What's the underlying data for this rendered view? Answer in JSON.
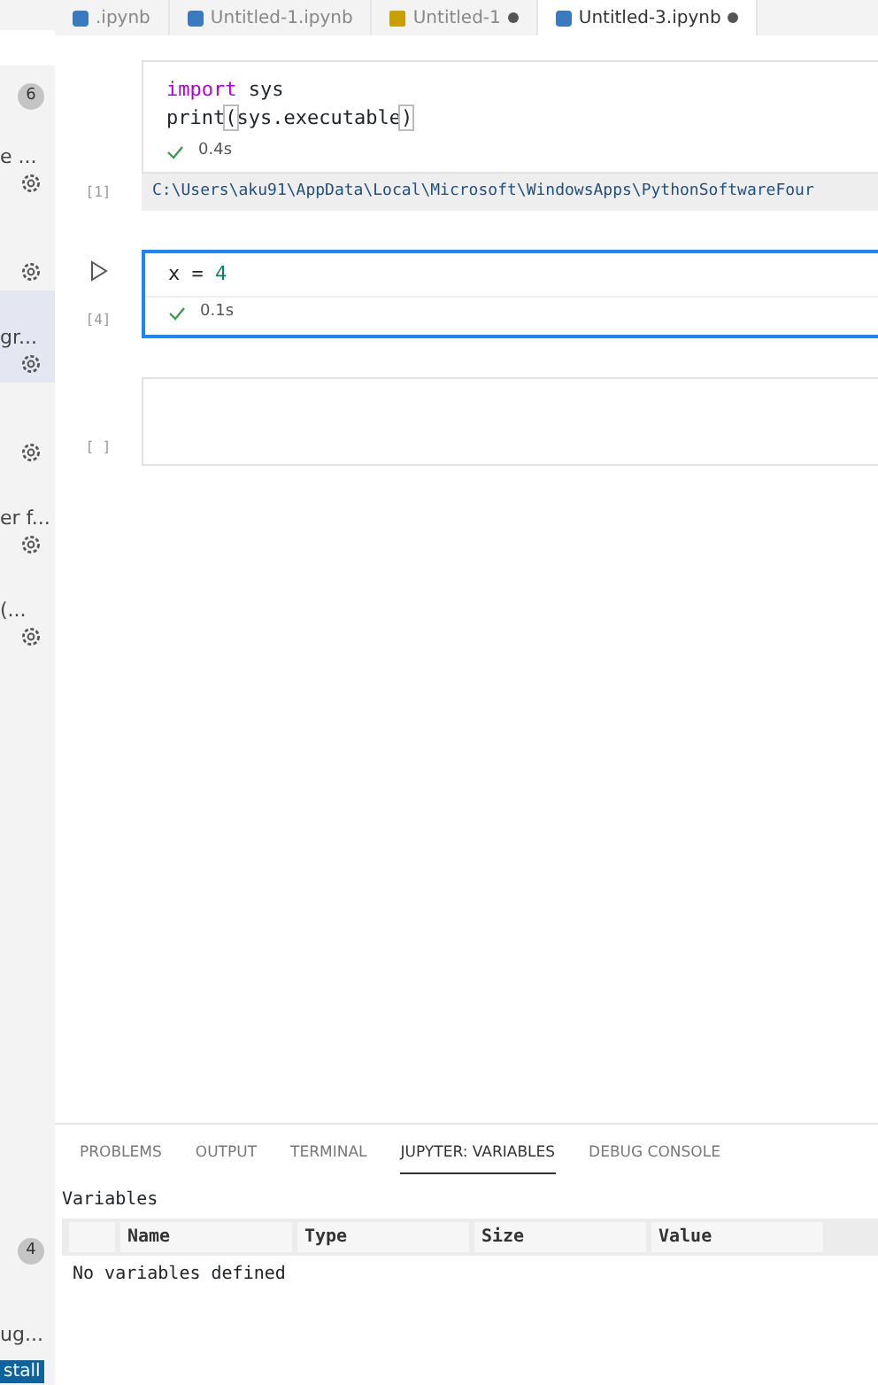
{
  "editor_tabs": [
    {
      "label": ".ipynb",
      "kind": "notebook",
      "dirty": false,
      "selected": false
    },
    {
      "label": "Untitled-1.ipynb",
      "kind": "notebook",
      "dirty": false,
      "selected": false
    },
    {
      "label": "Untitled-1",
      "kind": "json",
      "dirty": true,
      "selected": false
    },
    {
      "label": "Untitled-3.ipynb",
      "kind": "notebook",
      "dirty": true,
      "selected": true
    }
  ],
  "sidebar": [
    {
      "kind": "field"
    },
    {
      "kind": "badge",
      "text": "6"
    },
    {
      "kind": "entry",
      "text": "e ...",
      "selected": false
    },
    {
      "kind": "gear"
    },
    {
      "kind": "entry",
      "text": "gr...",
      "selected": true
    },
    {
      "kind": "gear"
    },
    {
      "kind": "entry",
      "text": "er f...",
      "selected": false
    },
    {
      "kind": "entry",
      "text": "(...",
      "selected": false
    },
    {
      "kind": "spacer"
    },
    {
      "kind": "badge",
      "text": "4"
    },
    {
      "kind": "entry_nogear",
      "text": "ug...",
      "selected": false
    },
    {
      "kind": "button",
      "text": "stall"
    }
  ],
  "cells": [
    {
      "kind": "code",
      "selected": false,
      "counter": "[1]",
      "lines": [
        [
          {
            "t": "import",
            "kind": "keyword"
          },
          {
            "t": " sys",
            "kind": "plain"
          }
        ],
        [
          {
            "t": "print",
            "kind": "plain"
          },
          {
            "t": "(",
            "kind": "bracket"
          },
          {
            "t": "sys.executable",
            "kind": "plain"
          },
          {
            "t": ")",
            "kind": "bracket"
          }
        ]
      ],
      "status": "0.4s",
      "output": "C:\\Users\\aku91\\AppData\\Local\\Microsoft\\WindowsApps\\PythonSoftwareFour"
    },
    {
      "kind": "code",
      "selected": true,
      "counter": "[4]",
      "lines": [
        [
          {
            "t": "x",
            "kind": "plain"
          },
          {
            "t": " = ",
            "kind": "plain"
          },
          {
            "t": "4",
            "kind": "number"
          }
        ]
      ],
      "status": "0.1s"
    },
    {
      "kind": "code",
      "selected": false,
      "counter": "[ ]"
    }
  ],
  "panel": {
    "tabs": [
      {
        "label": "PROBLEMS",
        "selected": false
      },
      {
        "label": "OUTPUT",
        "selected": false
      },
      {
        "label": "TERMINAL",
        "selected": false
      },
      {
        "label": "JUPYTER: VARIABLES",
        "selected": true
      },
      {
        "label": "DEBUG CONSOLE",
        "selected": false
      }
    ],
    "title": "Variables",
    "columns": [
      "Name",
      "Type",
      "Size",
      "Value"
    ],
    "empty_message": "No variables defined"
  }
}
